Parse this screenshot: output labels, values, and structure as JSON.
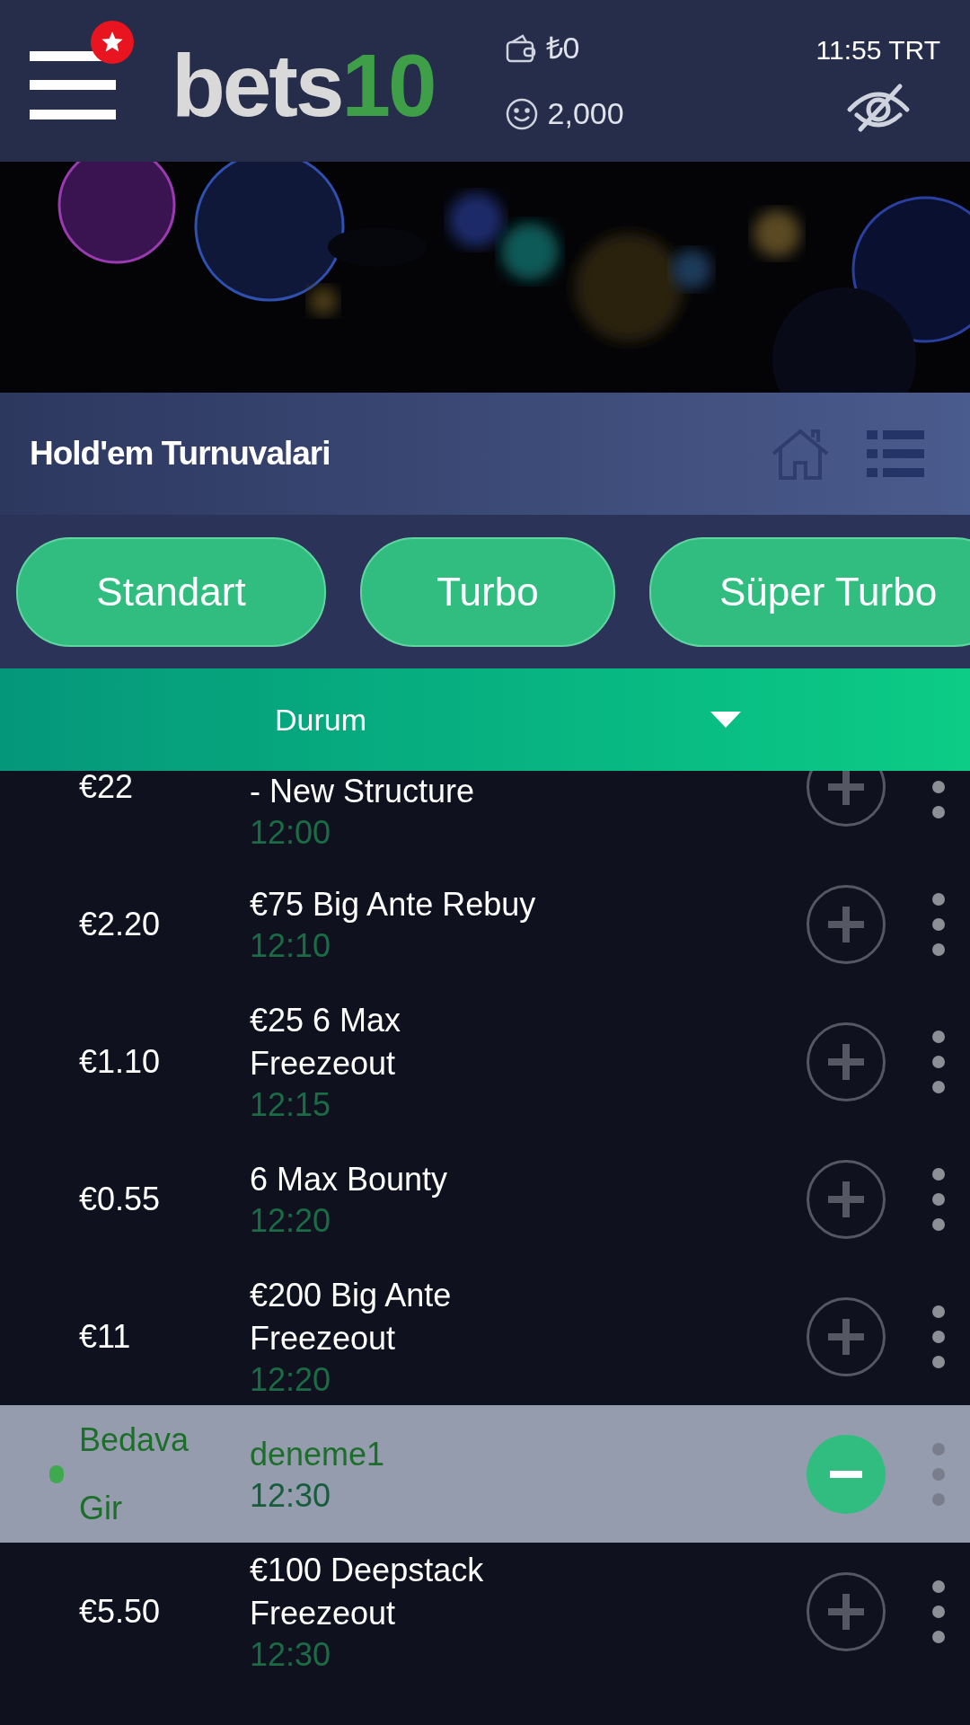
{
  "header": {
    "logo": {
      "word": "bets",
      "number": "10"
    },
    "menu_badge": true,
    "balance": "₺0",
    "points": "2,000",
    "clock": "11:55 TRT"
  },
  "section": {
    "title": "Hold'em Turnuvalari"
  },
  "filters": [
    {
      "label": "Standart"
    },
    {
      "label": "Turbo"
    },
    {
      "label": "Süper Turbo"
    }
  ],
  "dropdown": {
    "label": "Durum"
  },
  "tournaments": [
    {
      "price": "€22",
      "title": "- New Structure",
      "time": "12:00",
      "selected": false
    },
    {
      "price": "€2.20",
      "title": "€75 Big Ante Rebuy",
      "time": "12:10",
      "selected": false
    },
    {
      "price": "€1.10",
      "title": "€25 6 Max\nFreezeout",
      "time": "12:15",
      "selected": false
    },
    {
      "price": "€0.55",
      "title": "6 Max Bounty",
      "time": "12:20",
      "selected": false
    },
    {
      "price": "€11",
      "title": "€200 Big Ante\nFreezeout",
      "time": "12:20",
      "selected": false
    },
    {
      "price": "Bedava\nGir",
      "title": "deneme1",
      "time": "12:30",
      "selected": true
    },
    {
      "price": "€5.50",
      "title": "€100 Deepstack\nFreezeout",
      "time": "12:30",
      "selected": false
    }
  ]
}
